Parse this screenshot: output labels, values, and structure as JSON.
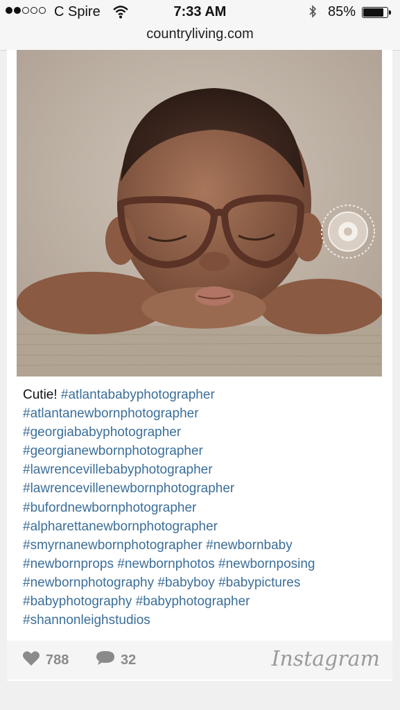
{
  "status_bar": {
    "carrier": "C Spire",
    "time": "7:33 AM",
    "battery": "85%",
    "battery_level": 0.85
  },
  "browser": {
    "url": "countryliving.com"
  },
  "post": {
    "caption_text": "Cutie!",
    "hashtags": [
      "#atlantababyphotographer",
      "#atlantanewbornphotographer",
      "#georgiababyphotographer",
      "#georgianewbornphotographer",
      "#lawrencevillebabyphotographer",
      "#lawrencevillenewbornphotographer",
      "#bufordnewbornphotographer",
      "#alpharettanewbornphotographer",
      "#smyrnanewbornphotographer",
      "#newbornbaby",
      "#newbornprops",
      "#newbornphotos",
      "#newbornposing",
      "#newbornphotography",
      "#babyboy",
      "#babypictures",
      "#babyphotography",
      "#babyphotographer",
      "#shannonleighstudios"
    ],
    "likes": "788",
    "comments": "32",
    "brand": "Instagram"
  }
}
